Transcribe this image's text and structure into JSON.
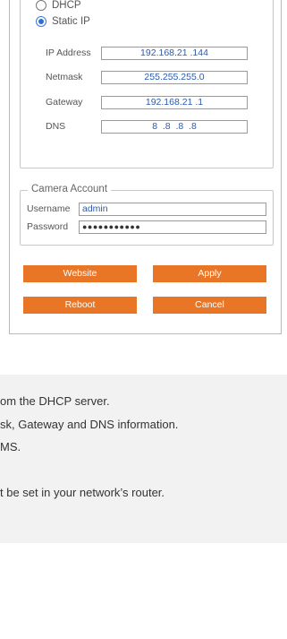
{
  "network": {
    "dhcp_label": "DHCP",
    "static_label": "Static IP",
    "fields": [
      {
        "label": "IP Address",
        "value": "192.168.21 .144"
      },
      {
        "label": "Netmask",
        "value": "255.255.255.0"
      },
      {
        "label": "Gateway",
        "value": "192.168.21 .1"
      },
      {
        "label": "DNS",
        "value": "8  .8  .8  .8"
      }
    ]
  },
  "account": {
    "legend": "Camera Account",
    "username_label": "Username",
    "username_value": "admin",
    "password_label": "Password",
    "password_value": "●●●●●●●●●●●"
  },
  "buttons": {
    "website": "Website",
    "apply": "Apply",
    "reboot": "Reboot",
    "cancel": "Cancel"
  },
  "accent_color": "#e97627",
  "help_lines": [
    "om the DHCP server.",
    "sk, Gateway and DNS information.",
    "MS.",
    "t be set in your network’s router."
  ]
}
